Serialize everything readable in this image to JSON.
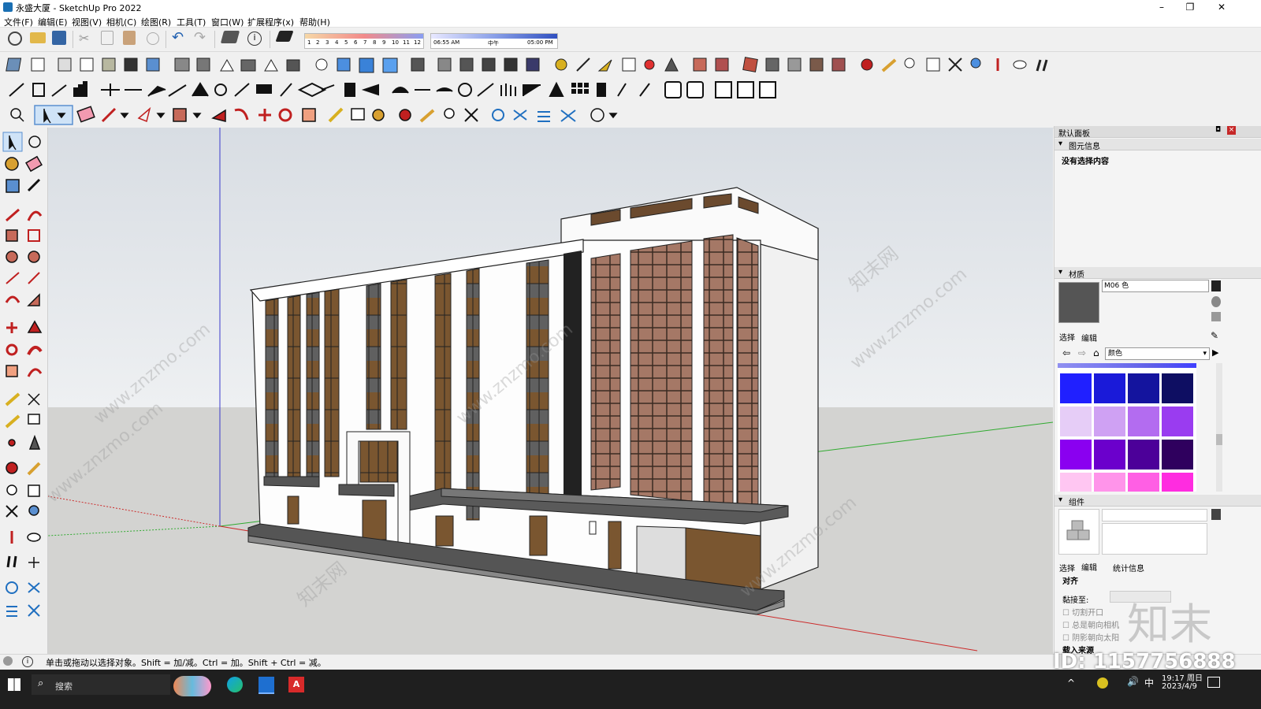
{
  "window": {
    "title": "永盛大厦 - SketchUp Pro 2022",
    "controls": [
      "–",
      "❐",
      "✕"
    ]
  },
  "menu": [
    "文件(F)",
    "编辑(E)",
    "视图(V)",
    "相机(C)",
    "绘图(R)",
    "工具(T)",
    "窗口(W)",
    "扩展程序(x)",
    "帮助(H)"
  ],
  "shadow_bar": {
    "month_ticks": [
      "1",
      "2",
      "3",
      "4",
      "5",
      "6",
      "7",
      "8",
      "9",
      "10",
      "11",
      "12"
    ],
    "time_start": "06:55 AM",
    "time_mid": "中午",
    "time_end": "05:00 PM"
  },
  "tray": {
    "title": "默认面板",
    "entity_info": {
      "header": "图元信息",
      "message": "没有选择内容"
    },
    "materials": {
      "header": "材质",
      "material_name": "M06 色",
      "tab_select": "选择",
      "tab_edit": "编辑",
      "library": "颜色",
      "swatches": [
        [
          "#2020ff",
          "#1a1ad9",
          "#14149e",
          "#0e0e62"
        ],
        [
          "#e6cdf7",
          "#cfa1f3",
          "#b36cf0",
          "#9a3cf0"
        ],
        [
          "#8a00f0",
          "#6b00cc",
          "#4c0099",
          "#2f005e"
        ],
        [
          "#ffc6f2",
          "#ff94ea",
          "#ff5fe4",
          "#ff2ce0"
        ]
      ]
    },
    "components": {
      "header": "组件",
      "tab_select": "选择",
      "tab_edit": "编辑",
      "tab_stats": "统计信息",
      "align_label": "对齐",
      "glue_label": "黏接至:",
      "options": [
        "切割开口",
        "总是朝向相机",
        "阴影朝向太阳"
      ],
      "load_label": "载入来源"
    }
  },
  "statusbar": {
    "hint": "单击或拖动以选择对象。Shift = 加/减。Ctrl = 加。Shift + Ctrl = 减。"
  },
  "taskbar": {
    "search_placeholder": "搜索",
    "ime": "中",
    "time": "19:17 周日",
    "date": "2023/4/9"
  },
  "watermark": {
    "site": "www.znzmo.com",
    "brand": "知末",
    "brand_cn": "知末网",
    "id": "ID: 1157756888"
  }
}
